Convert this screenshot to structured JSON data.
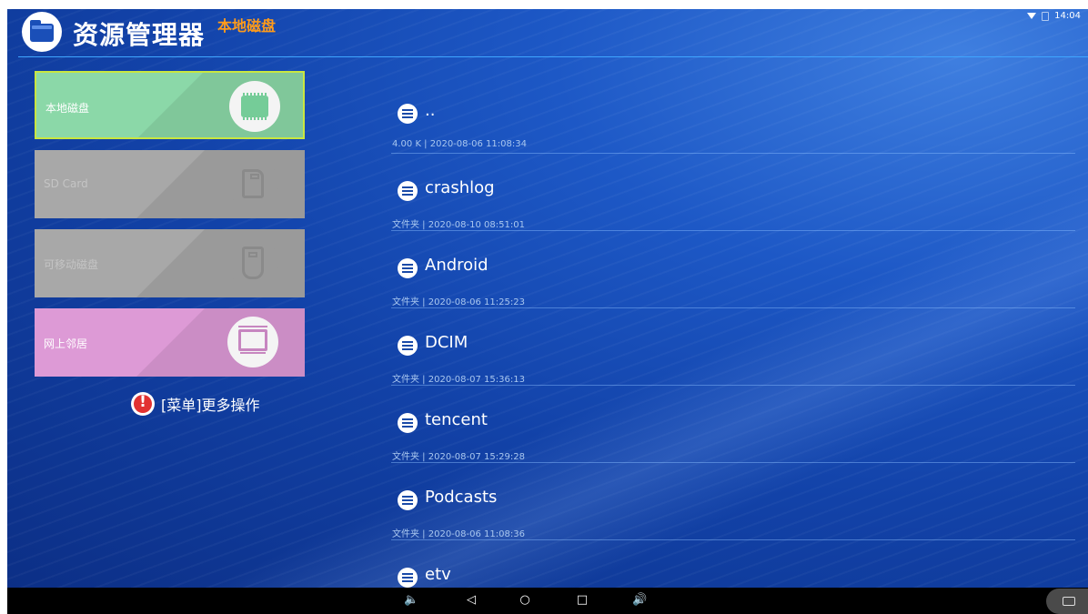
{
  "header": {
    "app_title": "资源管理器",
    "location_title": "本地磁盘",
    "clock": "14:04"
  },
  "drives": [
    {
      "label": "本地磁盘",
      "icon": "chip-icon",
      "color": "#8bd8a8",
      "selected": true
    },
    {
      "label": "SD Card",
      "icon": "sd-card-icon",
      "color": "#a8a8a8",
      "enabled": false
    },
    {
      "label": "可移动磁盘",
      "icon": "usb-drive-icon",
      "color": "#a8a8a8",
      "enabled": false
    },
    {
      "label": "网上邻居",
      "icon": "network-screen-icon",
      "color": "#dd9ad6"
    }
  ],
  "menu_hint": {
    "icon": "alert-icon",
    "icon_glyph": "!",
    "text": "[菜单]更多操作"
  },
  "files": [
    {
      "name": "..",
      "meta": "4.00 K | 2020-08-06 11:08:34"
    },
    {
      "name": "crashlog",
      "meta": "文件夹 | 2020-08-10 08:51:01"
    },
    {
      "name": "Android",
      "meta": "文件夹 | 2020-08-06 11:25:23"
    },
    {
      "name": "DCIM",
      "meta": "文件夹 | 2020-08-07 15:36:13"
    },
    {
      "name": "tencent",
      "meta": "文件夹 | 2020-08-07 15:29:28"
    },
    {
      "name": "Podcasts",
      "meta": "文件夹 | 2020-08-06 11:08:36"
    },
    {
      "name": "etv",
      "meta": ""
    }
  ],
  "navbar": {
    "vol_down": "🔈",
    "back": "◁",
    "home": "○",
    "recent": "□",
    "vol_up": "🔊"
  }
}
